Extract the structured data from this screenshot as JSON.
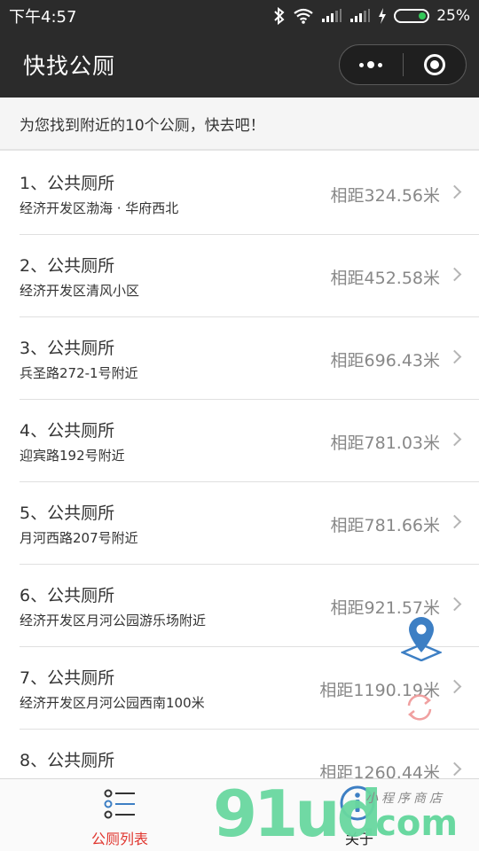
{
  "status_bar": {
    "time": "下午4:57",
    "battery_percent": "25%",
    "battery_level": 25,
    "icons": [
      "bluetooth-icon",
      "wifi-icon",
      "signal-icon",
      "signal-icon",
      "charging-icon",
      "battery-icon"
    ]
  },
  "header": {
    "title": "快找公厕",
    "menu_icon": "more-dots-icon",
    "close_icon": "target-icon"
  },
  "notice": "为您找到附近的10个公厕，快去吧！",
  "toilets": [
    {
      "name": "1、公共厕所",
      "address": "经济开发区渤海 · 华府西北",
      "distance": "相距324.56米"
    },
    {
      "name": "2、公共厕所",
      "address": "经济开发区清风小区",
      "distance": "相距452.58米"
    },
    {
      "name": "3、公共厕所",
      "address": "兵圣路272-1号附近",
      "distance": "相距696.43米"
    },
    {
      "name": "4、公共厕所",
      "address": "迎宾路192号附近",
      "distance": "相距781.03米"
    },
    {
      "name": "5、公共厕所",
      "address": "月河西路207号附近",
      "distance": "相距781.66米"
    },
    {
      "name": "6、公共厕所",
      "address": "经济开发区月河公园游乐场附近",
      "distance": "相距921.57米"
    },
    {
      "name": "7、公共厕所",
      "address": "经济开发区月河公园西南100米",
      "distance": "相距1190.19米"
    },
    {
      "name": "8、公共厕所",
      "address": "",
      "distance": "相距1260.44米"
    }
  ],
  "floating": {
    "locate_icon": "map-pin-icon",
    "refresh_icon": "refresh-icon"
  },
  "tabbar": {
    "tabs": [
      {
        "label": "公厕列表",
        "icon": "list-icon",
        "active": true
      },
      {
        "label": "关于",
        "icon": "info-icon",
        "active": false
      }
    ]
  },
  "watermark": {
    "brand": "91ud",
    "suffix": ".com",
    "tagline": "小程序商店"
  },
  "colors": {
    "header_bg": "#2b2b2b",
    "active_tab": "#e0362f",
    "pin_blue": "#3d7fc4",
    "watermark_green": "#69d8a0"
  }
}
